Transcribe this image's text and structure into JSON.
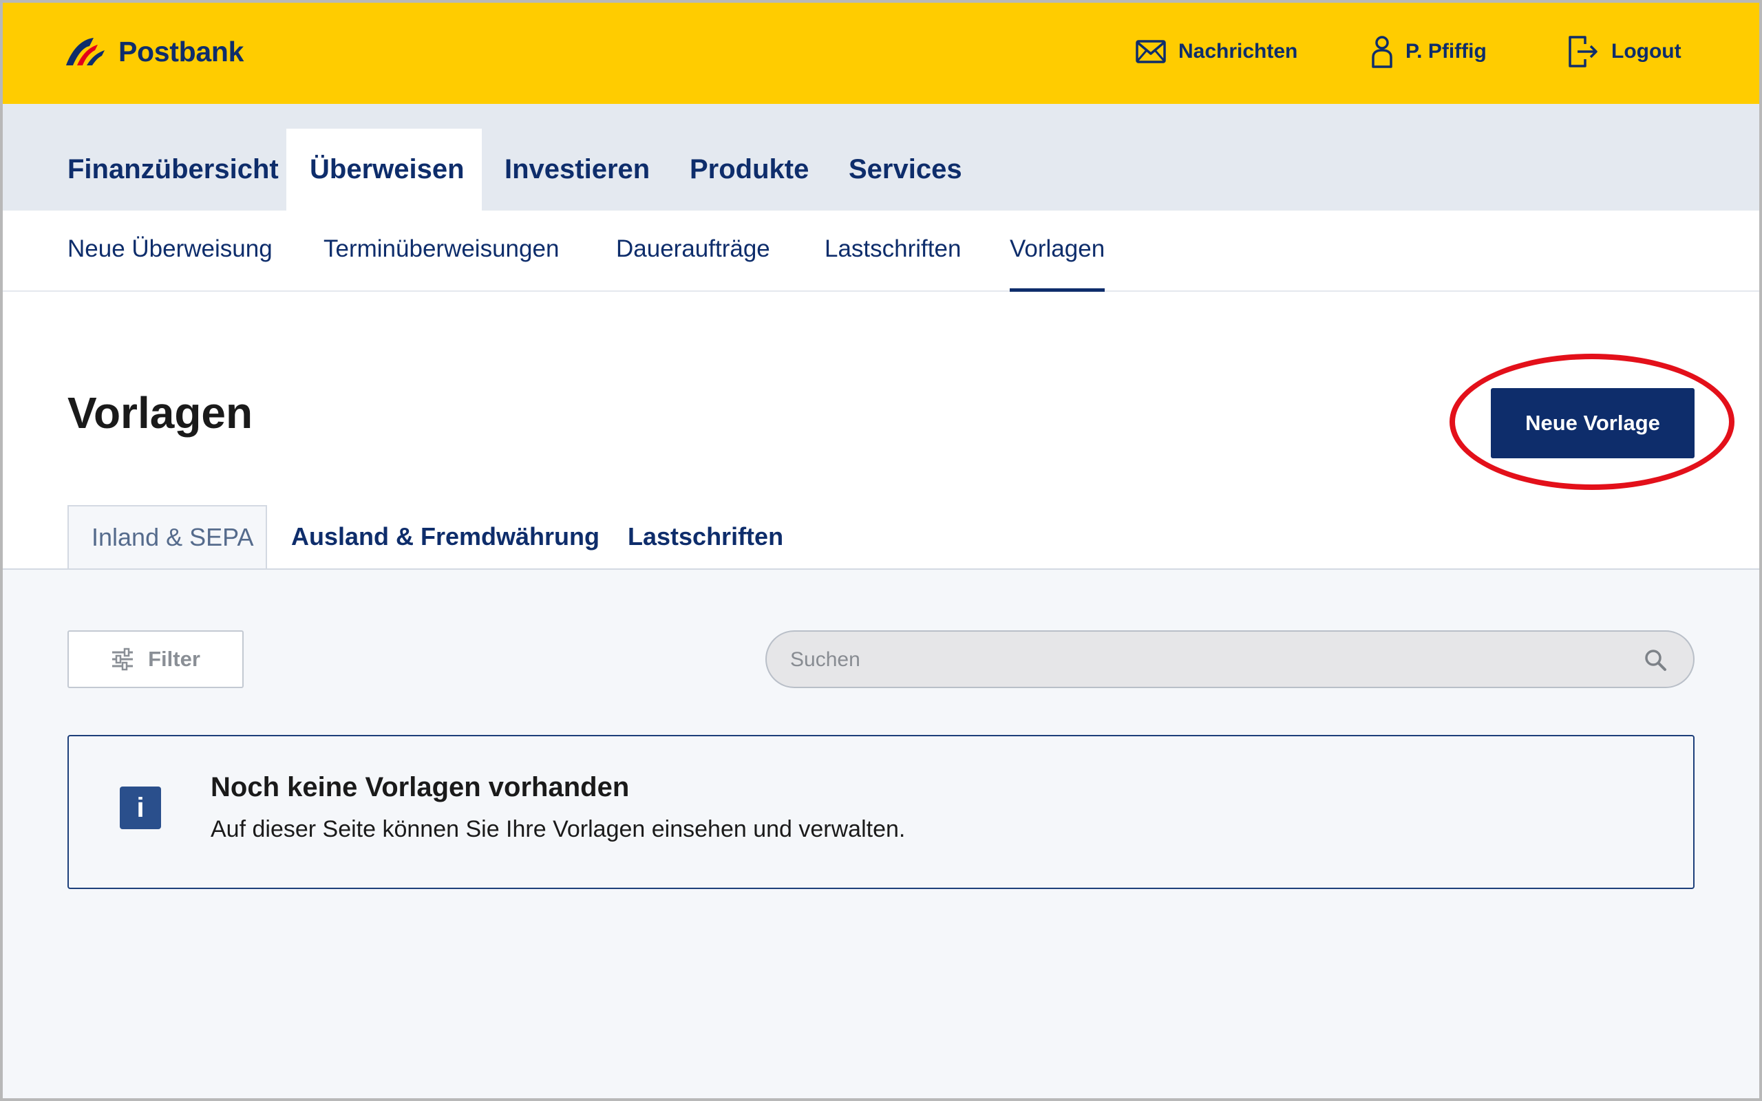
{
  "header": {
    "brand": "Postbank",
    "links": {
      "messages": "Nachrichten",
      "user": "P. Pfiffig",
      "logout": "Logout"
    }
  },
  "main_nav": {
    "tabs": [
      {
        "label": "Finanzübersicht",
        "active": false
      },
      {
        "label": "Überweisen",
        "active": true
      },
      {
        "label": "Investieren",
        "active": false
      },
      {
        "label": "Produkte",
        "active": false
      },
      {
        "label": "Services",
        "active": false
      }
    ]
  },
  "sub_nav": {
    "items": [
      {
        "label": "Neue Überweisung",
        "active": false
      },
      {
        "label": "Terminüberweisungen",
        "active": false
      },
      {
        "label": "Daueraufträge",
        "active": false
      },
      {
        "label": "Lastschriften",
        "active": false
      },
      {
        "label": "Vorlagen",
        "active": true
      }
    ]
  },
  "page": {
    "title": "Vorlagen",
    "new_button": "Neue Vorlage"
  },
  "content_tabs": [
    {
      "label": "Inland & SEPA",
      "active": true
    },
    {
      "label": "Ausland & Fremdwährung",
      "active": false
    },
    {
      "label": "Lastschriften",
      "active": false
    }
  ],
  "toolbar": {
    "filter_label": "Filter",
    "search_placeholder": "Suchen",
    "search_value": ""
  },
  "info": {
    "icon": "i",
    "title": "Noch keine Vorlagen vorhanden",
    "text": "Auf dieser Seite können Sie Ihre Vorlagen einsehen und verwalten."
  },
  "colors": {
    "header_yellow": "#ffcc00",
    "primary_navy": "#0e2d6b",
    "nav_background": "#e4e9f0",
    "content_background": "#f5f7fa",
    "highlight_red": "#e3101a",
    "logo_red": "#e3001b"
  },
  "icons": {
    "messages": "envelope-icon",
    "user": "user-icon",
    "logout": "logout-icon",
    "filter": "sliders-icon",
    "search": "magnifier-icon",
    "info": "info-icon"
  },
  "annotation": {
    "highlight": "red ellipse around the Neue Vorlage button"
  }
}
